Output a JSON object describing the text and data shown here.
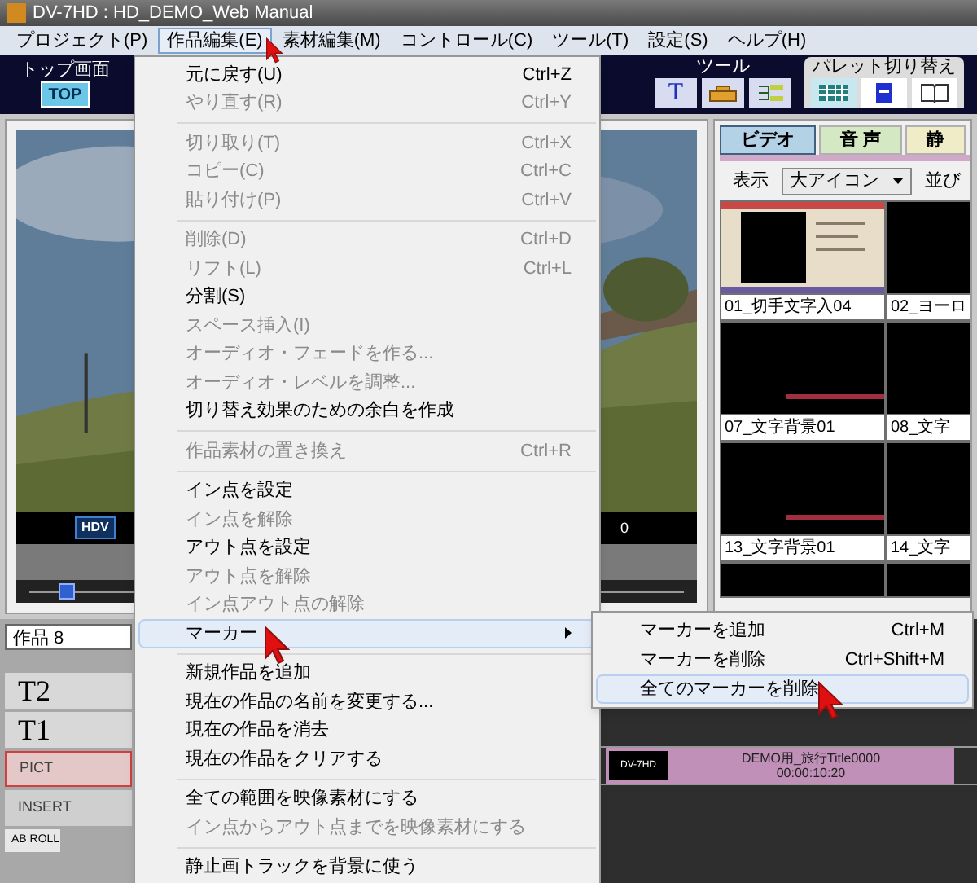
{
  "window": {
    "title": "DV-7HD : HD_DEMO_Web Manual"
  },
  "menubar": [
    {
      "label": "プロジェクト(P)",
      "selected": false
    },
    {
      "label": "作品編集(E)",
      "selected": true
    },
    {
      "label": "素材編集(M)",
      "selected": false
    },
    {
      "label": "コントロール(C)",
      "selected": false
    },
    {
      "label": "ツール(T)",
      "selected": false
    },
    {
      "label": "設定(S)",
      "selected": false
    },
    {
      "label": "ヘルプ(H)",
      "selected": false
    }
  ],
  "toolbar": {
    "top_label": "トップ画面",
    "top_button": "TOP",
    "tools_label": "ツール",
    "tool_text_button": "T",
    "palette_label": "パレット切り替え"
  },
  "preview": {
    "format_badge": "HDV",
    "counter": "0"
  },
  "palette": {
    "tabs": [
      {
        "label": "ビデオ",
        "selected": true,
        "color": "#b4d2e6"
      },
      {
        "label": "音 声",
        "selected": false,
        "color": "#d4e8c4"
      },
      {
        "label": "静",
        "selected": false,
        "color": "#f0ecc8"
      }
    ],
    "view_label": "表示",
    "view_select": "大アイコン",
    "sort_label": "並び",
    "thumbnails": [
      {
        "label": "01_切手文字入04",
        "kind": "stamp"
      },
      {
        "label": "02_ヨーロ",
        "kind": "dark"
      },
      {
        "label": "07_文字背景01",
        "kind": "streak"
      },
      {
        "label": "08_文字",
        "kind": "dark"
      },
      {
        "label": "13_文字背景01",
        "kind": "streak"
      },
      {
        "label": "14_文字",
        "kind": "dark"
      }
    ]
  },
  "timeline": {
    "project": "作品 8",
    "tracks": [
      {
        "label": "T2",
        "kind": "title"
      },
      {
        "label": "T1",
        "kind": "title"
      },
      {
        "label": "PICT",
        "kind": "pict"
      },
      {
        "label": "INSERT",
        "kind": "insert"
      },
      {
        "label": "AB ROLL",
        "kind": "abroll"
      }
    ],
    "clip": {
      "thumb_label": "DV-7HD",
      "title": "DEMO用_旅行Title0000",
      "timecode": "00:00:10:20"
    }
  },
  "edit_menu": [
    {
      "kind": "item",
      "label": "元に戻す(U)",
      "shortcut": "Ctrl+Z",
      "disabled": false,
      "selected": false
    },
    {
      "kind": "item",
      "label": "やり直す(R)",
      "shortcut": "Ctrl+Y",
      "disabled": true,
      "selected": false
    },
    {
      "kind": "separator"
    },
    {
      "kind": "item",
      "label": "切り取り(T)",
      "shortcut": "Ctrl+X",
      "disabled": true,
      "selected": false
    },
    {
      "kind": "item",
      "label": "コピー(C)",
      "shortcut": "Ctrl+C",
      "disabled": true,
      "selected": false
    },
    {
      "kind": "item",
      "label": "貼り付け(P)",
      "shortcut": "Ctrl+V",
      "disabled": true,
      "selected": false
    },
    {
      "kind": "separator"
    },
    {
      "kind": "item",
      "label": "削除(D)",
      "shortcut": "Ctrl+D",
      "disabled": true,
      "selected": false
    },
    {
      "kind": "item",
      "label": "リフト(L)",
      "shortcut": "Ctrl+L",
      "disabled": true,
      "selected": false
    },
    {
      "kind": "item",
      "label": "分割(S)",
      "disabled": false,
      "selected": false
    },
    {
      "kind": "item",
      "label": "スペース挿入(I)",
      "disabled": true,
      "selected": false
    },
    {
      "kind": "item",
      "label": "オーディオ・フェードを作る...",
      "disabled": true,
      "selected": false
    },
    {
      "kind": "item",
      "label": "オーディオ・レベルを調整...",
      "disabled": true,
      "selected": false
    },
    {
      "kind": "item",
      "label": "切り替え効果のための余白を作成",
      "disabled": false,
      "selected": false
    },
    {
      "kind": "separator"
    },
    {
      "kind": "item",
      "label": "作品素材の置き換え",
      "shortcut": "Ctrl+R",
      "disabled": true,
      "selected": false
    },
    {
      "kind": "separator"
    },
    {
      "kind": "item",
      "label": "イン点を設定",
      "disabled": false,
      "selected": false
    },
    {
      "kind": "item",
      "label": "イン点を解除",
      "disabled": true,
      "selected": false
    },
    {
      "kind": "item",
      "label": "アウト点を設定",
      "disabled": false,
      "selected": false
    },
    {
      "kind": "item",
      "label": "アウト点を解除",
      "disabled": true,
      "selected": false
    },
    {
      "kind": "item",
      "label": "イン点アウト点の解除",
      "disabled": true,
      "selected": false
    },
    {
      "kind": "submenu",
      "label": "マーカー",
      "disabled": false,
      "selected": true
    },
    {
      "kind": "separator"
    },
    {
      "kind": "item",
      "label": "新規作品を追加",
      "disabled": false,
      "selected": false
    },
    {
      "kind": "item",
      "label": "現在の作品の名前を変更する...",
      "disabled": false,
      "selected": false
    },
    {
      "kind": "item",
      "label": "現在の作品を消去",
      "disabled": false,
      "selected": false
    },
    {
      "kind": "item",
      "label": "現在の作品をクリアする",
      "disabled": false,
      "selected": false
    },
    {
      "kind": "separator"
    },
    {
      "kind": "item",
      "label": "全ての範囲を映像素材にする",
      "disabled": false,
      "selected": false
    },
    {
      "kind": "item",
      "label": "イン点からアウト点までを映像素材にする",
      "disabled": true,
      "selected": false
    },
    {
      "kind": "separator"
    },
    {
      "kind": "item",
      "label": "静止画トラックを背景に使う",
      "disabled": false,
      "selected": false
    }
  ],
  "marker_menu": [
    {
      "label": "マーカーを追加",
      "shortcut": "Ctrl+M",
      "selected": false
    },
    {
      "label": "マーカーを削除",
      "shortcut": "Ctrl+Shift+M",
      "selected": false
    },
    {
      "label": "全てのマーカーを削除",
      "selected": true
    }
  ]
}
